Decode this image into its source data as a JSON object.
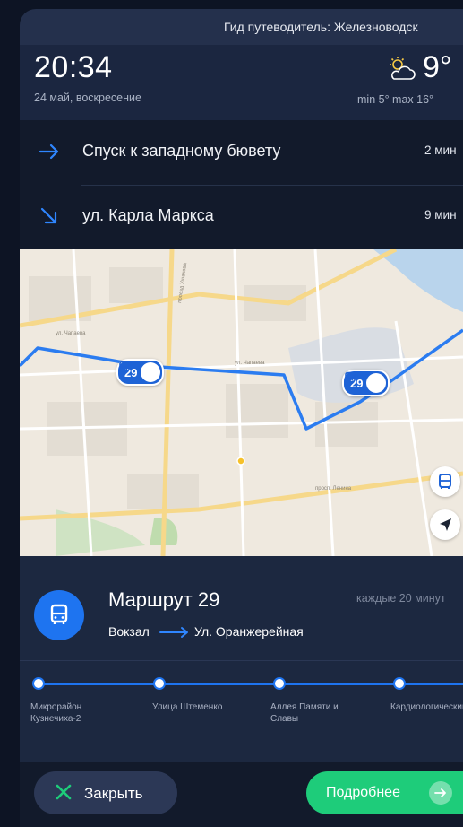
{
  "header": {
    "guide_title": "Гид путеводитель: Железноводск"
  },
  "status": {
    "time": "20:34",
    "date": "24 май, воскресение",
    "weather_icon": "partly-cloudy-icon",
    "temperature": "9°",
    "min_max": "min 5°  max 16°"
  },
  "directions": [
    {
      "icon": "arrow-right-icon",
      "name": "Спуск к западному бювету",
      "minutes": "2 мин"
    },
    {
      "icon": "arrow-down-right-icon",
      "name": "ул. Карла Маркса",
      "minutes": "9 мин"
    }
  ],
  "map": {
    "markers": [
      {
        "route_number": "29"
      },
      {
        "route_number": "29"
      }
    ],
    "street_labels": [
      "ул. Чапаева",
      "просп. Ленина",
      "проезд Ушакова",
      "ул. Чапаева"
    ],
    "buttons": {
      "transport": "bus-icon",
      "locate": "navigation-arrow-icon"
    }
  },
  "route": {
    "icon": "bus-icon",
    "title": "Маршрут 29",
    "frequency": "каждые 20 минут",
    "from": "Вокзал",
    "to": "Ул. Оранжерейная",
    "stops": [
      "Микрорайон Кузнечиха-2",
      "Улица Штеменко",
      "Аллея Памяти и Славы",
      "Кардиологический центр"
    ]
  },
  "actions": {
    "close_label": "Закрыть",
    "more_label": "Подробнее"
  },
  "colors": {
    "accent_blue": "#1e74f0",
    "accent_green": "#1ecc7a",
    "background": "#0d1424"
  }
}
